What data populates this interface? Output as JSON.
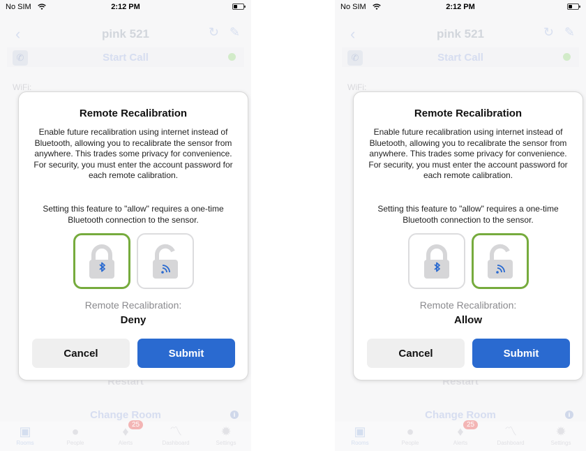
{
  "status_bar": {
    "carrier": "No SIM",
    "time": "2:12 PM"
  },
  "nav": {
    "title": "pink 521"
  },
  "background": {
    "start_call": "Start Call",
    "wifi_label": "WiFi:",
    "restart": "Restart",
    "change_room": "Change Room"
  },
  "tabs": [
    {
      "label": "Rooms",
      "icon": "rooms-icon"
    },
    {
      "label": "People",
      "icon": "people-icon"
    },
    {
      "label": "Alerts",
      "icon": "bell-icon",
      "badge": "25"
    },
    {
      "label": "Dashboard",
      "icon": "chart-icon"
    },
    {
      "label": "Settings",
      "icon": "gear-icon"
    }
  ],
  "modal": {
    "title": "Remote Recalibration",
    "body": "Enable future recalibration using internet instead of Bluetooth, allowing you to recalibrate the sensor from anywhere. This trades some privacy for convenience. For security, you must enter the account password for each remote calibration.",
    "note": "Setting this feature to \"allow\" requires a one-time Bluetooth connection to the sensor.",
    "recal_label": "Remote Recalibration:",
    "cancel_label": "Cancel",
    "submit_label": "Submit"
  },
  "screens": [
    {
      "selected": "deny",
      "recal_value": "Deny"
    },
    {
      "selected": "allow",
      "recal_value": "Allow"
    }
  ],
  "colors": {
    "selected_border": "#76ab3d",
    "submit": "#2a6ad0",
    "lock_icon_blue": "#2a6ad0"
  }
}
